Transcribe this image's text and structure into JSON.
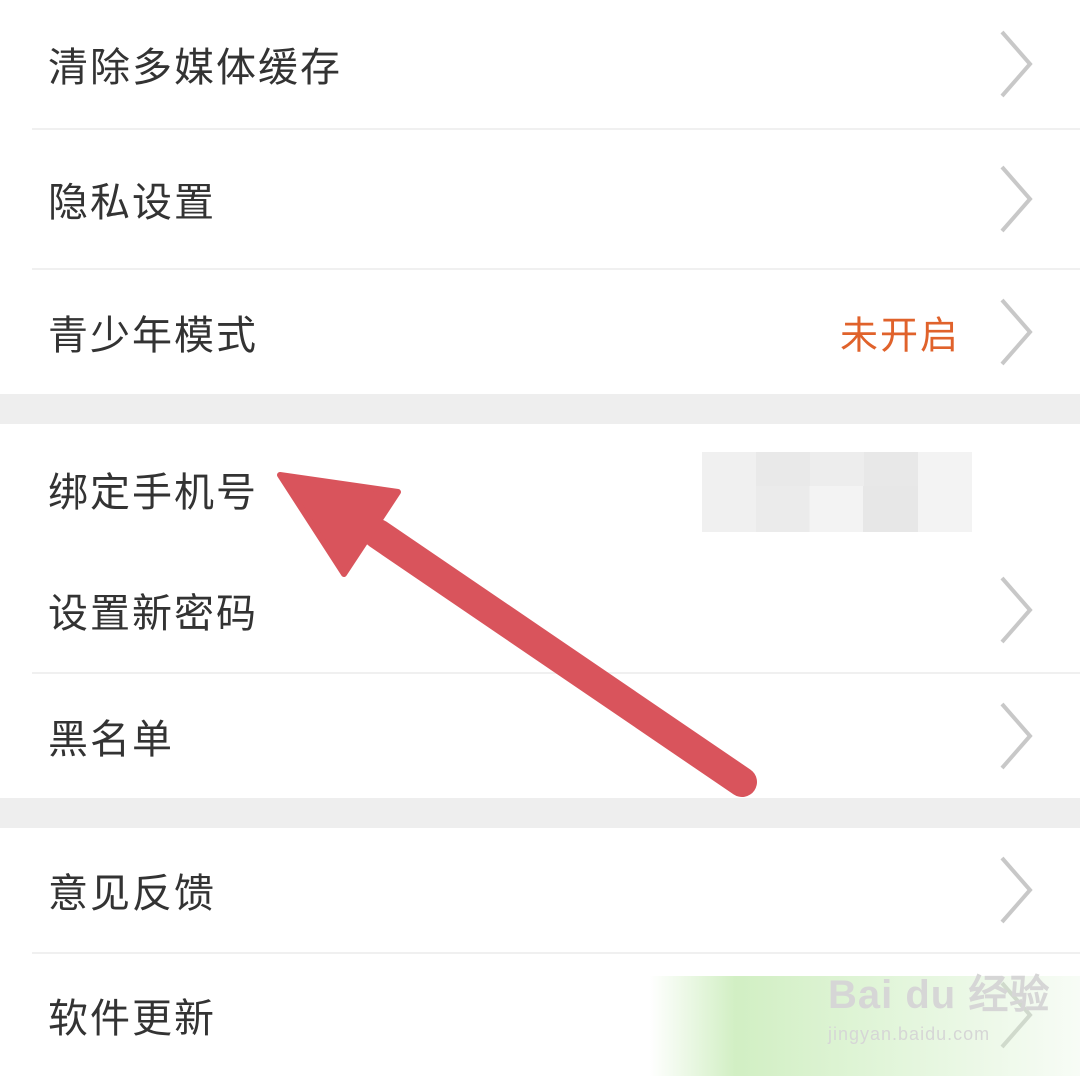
{
  "settings_groups": [
    {
      "items": [
        {
          "label": "清除多媒体缓存",
          "value": ""
        },
        {
          "label": "隐私设置",
          "value": ""
        },
        {
          "label": "青少年模式",
          "value": "未开启"
        }
      ]
    },
    {
      "items": [
        {
          "label": "绑定手机号",
          "value": ""
        },
        {
          "label": "设置新密码",
          "value": ""
        },
        {
          "label": "黑名单",
          "value": ""
        }
      ]
    },
    {
      "items": [
        {
          "label": "意见反馈",
          "value": ""
        },
        {
          "label": "软件更新",
          "value": ""
        }
      ]
    }
  ],
  "colors": {
    "label_text": "#333333",
    "status_value": "#e0622b",
    "chevron": "#c8c8c8",
    "group_gap": "#eeeeee",
    "annotation_arrow": "#d9545c"
  },
  "icons": {
    "row_chevron": "chevron-right-icon"
  },
  "watermark": {
    "brand": "Bai du 经验",
    "url": "jingyan.baidu.com"
  }
}
